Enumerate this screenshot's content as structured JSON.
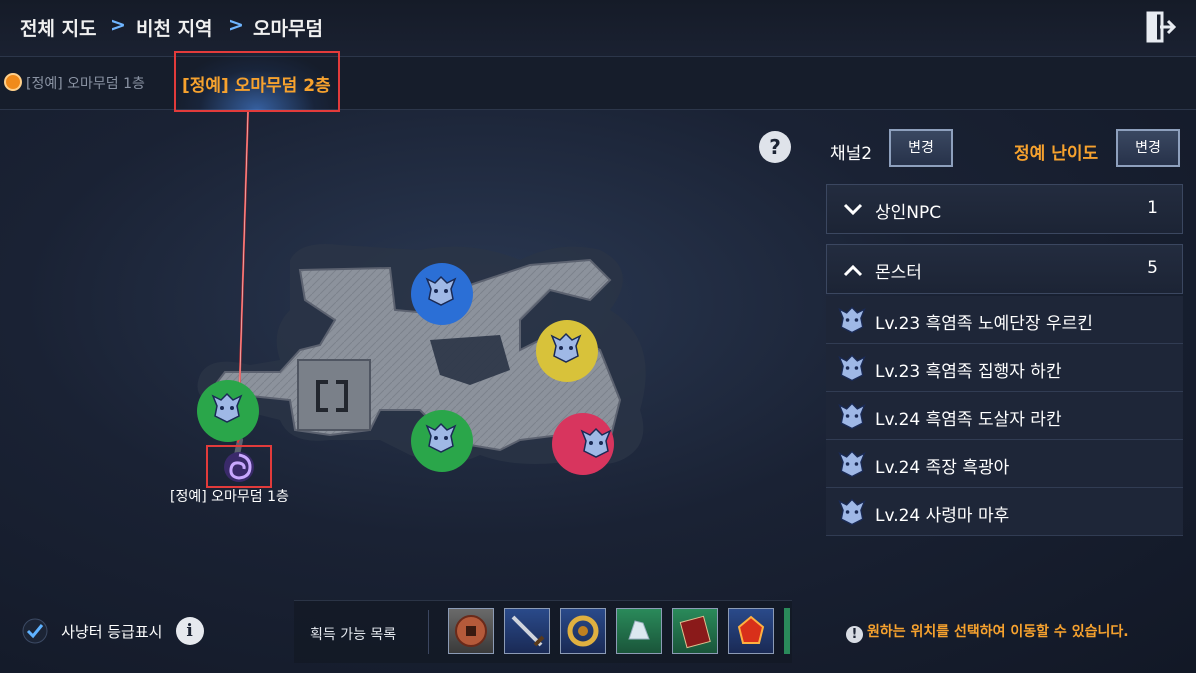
{
  "breadcrumb": {
    "level1": "전체 지도",
    "level2": "비천 지역",
    "level3": "오마무덤",
    "separator": ">"
  },
  "tabs": {
    "floor1": "[정예] 오마무덤 1층",
    "floor2": "[정예] 오마무덤 2층"
  },
  "map": {
    "help_glyph": "?",
    "portal_label": "[정예] 오마무덤 1층",
    "markers": [
      {
        "color": "#2b6fd6",
        "name": "blue-monster-marker"
      },
      {
        "color": "#d8c23a",
        "name": "yellow-monster-marker"
      },
      {
        "color": "#2aa64a",
        "name": "green-monster-marker-left"
      },
      {
        "color": "#2aa64a",
        "name": "green-monster-marker-center"
      },
      {
        "color": "#d8355e",
        "name": "pink-monster-marker"
      }
    ]
  },
  "panel": {
    "channel_label": "채널2",
    "channel_button": "변경",
    "difficulty_label": "정예 난이도",
    "difficulty_button": "변경",
    "npc_section": {
      "label": "상인NPC",
      "count": "1"
    },
    "monster_section": {
      "label": "몬스터",
      "count": "5"
    },
    "monsters": [
      "Lv.23 흑염족 노예단장 우르킨",
      "Lv.23 흑염족 집행자 하칸",
      "Lv.24 흑염족 도살자 라칸",
      "Lv.24 족장 흑광아",
      "Lv.24 사령마 마후"
    ]
  },
  "footer": {
    "checkbox_label": "사냥터 등급표시",
    "info_glyph": "i",
    "loot_label": "획득 가능 목록",
    "hint": "원하는 위치를 선택하여 이동할 수 있습니다.",
    "loot_items": [
      "coin-item-icon",
      "sword-item-icon",
      "gold-dragon-item-icon",
      "crystal-item-icon",
      "red-book-item-icon",
      "red-gem-item-icon"
    ]
  },
  "colors": {
    "accent_orange": "#f7a22e",
    "highlight_red": "#e23b3b",
    "chevron_blue": "#6fb5ff"
  }
}
